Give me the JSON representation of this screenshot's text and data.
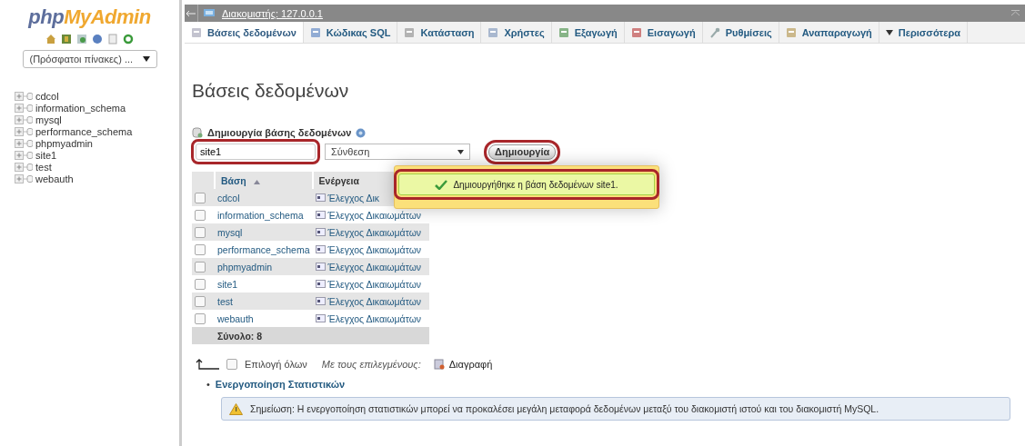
{
  "logo": {
    "prefix": "php",
    "name": "MyAdmin"
  },
  "sidebar": {
    "recent": "(Πρόσφατοι πίνακες) ...",
    "databases": [
      "cdcol",
      "information_schema",
      "mysql",
      "performance_schema",
      "phpmyadmin",
      "site1",
      "test",
      "webauth"
    ]
  },
  "breadcrumb": {
    "label": "Διακομιστής: 127.0.0.1"
  },
  "tabs": [
    {
      "label": "Βάσεις δεδομένων",
      "selected": true
    },
    {
      "label": "Κώδικας SQL",
      "selected": false
    },
    {
      "label": "Κατάσταση",
      "selected": false
    },
    {
      "label": "Χρήστες",
      "selected": false
    },
    {
      "label": "Εξαγωγή",
      "selected": false
    },
    {
      "label": "Εισαγωγή",
      "selected": false
    },
    {
      "label": "Ρυθμίσεις",
      "selected": false
    },
    {
      "label": "Αναπαραγωγή",
      "selected": false
    },
    {
      "label": "Περισσότερα",
      "kind": "menu",
      "selected": false
    }
  ],
  "heading": "Βάσεις δεδομένων",
  "create": {
    "title": "Δημιουργία βάσης δεδομένων",
    "name_value": "site1",
    "name_highlighted": true,
    "collation": "Σύνθεση",
    "button": "Δημιουργία",
    "button_highlighted": true
  },
  "notice": {
    "message": "Δημιουργήθηκε η βάση δεδομένων site1.",
    "highlighted": true
  },
  "table": {
    "columns": [
      {
        "label": "Βάση",
        "sorted": true
      },
      {
        "label": "Ενέργεια",
        "sorted": false
      }
    ],
    "rows": [
      {
        "name": "cdcol",
        "action": "Έλεγχος Δικ",
        "checked": false
      },
      {
        "name": "information_schema",
        "action": "Έλεγχος Δικαιωμάτων",
        "checked": false
      },
      {
        "name": "mysql",
        "action": "Έλεγχος Δικαιωμάτων",
        "checked": false
      },
      {
        "name": "performance_schema",
        "action": "Έλεγχος Δικαιωμάτων",
        "checked": false
      },
      {
        "name": "phpmyadmin",
        "action": "Έλεγχος Δικαιωμάτων",
        "checked": false
      },
      {
        "name": "site1",
        "action": "Έλεγχος Δικαιωμάτων",
        "checked": false
      },
      {
        "name": "test",
        "action": "Έλεγχος Δικαιωμάτων",
        "checked": false
      },
      {
        "name": "webauth",
        "action": "Έλεγχος Δικαιωμάτων",
        "checked": false
      }
    ],
    "total": "Σύνολο: 8"
  },
  "footer": {
    "check_all": "Επιλογή όλων",
    "check_all_checked": false,
    "with_selected": "Με τους επιλεγμένους:",
    "delete": "Διαγραφή"
  },
  "stats_bullet": "•",
  "stats_link": "Ενεργοποίηση Στατιστικών",
  "note": "Σημείωση: Η ενεργοποίηση στατιστικών μπορεί να προκαλέσει μεγάλη μεταφορά δεδομένων μεταξύ του διακομιστή ιστού και του διακομιστή MySQL."
}
